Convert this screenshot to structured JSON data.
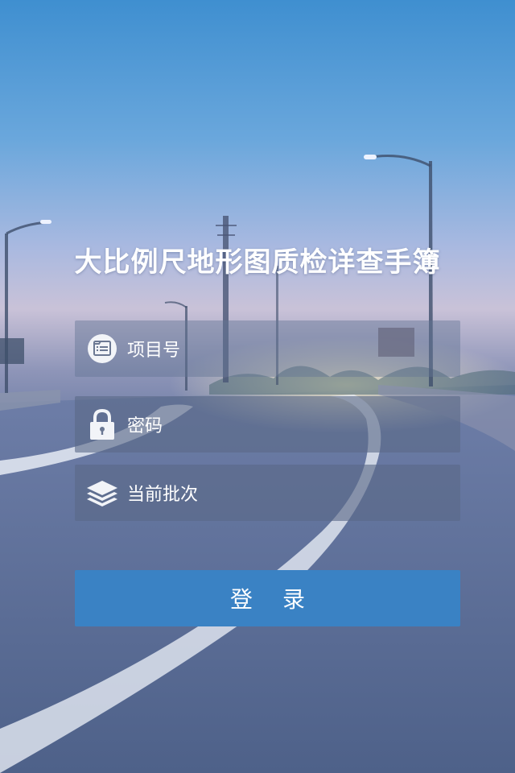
{
  "app": {
    "title": "大比例尺地形图质检详查手簿"
  },
  "form": {
    "project_label": "项目号",
    "password_label": "密码",
    "batch_label": "当前批次",
    "login_label": "登 录"
  },
  "icons": {
    "project": "list-document-icon",
    "password": "lock-icon",
    "batch": "layers-icon"
  },
  "colors": {
    "button": "#3a82c4",
    "text": "#ffffff"
  }
}
